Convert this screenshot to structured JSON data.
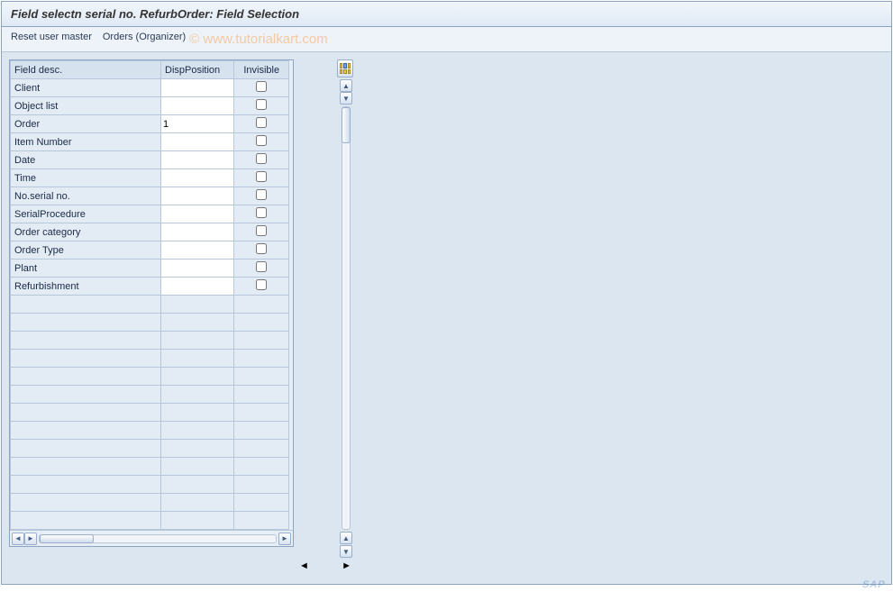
{
  "title": "Field selectn serial no. RefurbOrder: Field Selection",
  "toolbar": {
    "reset_label": "Reset user master",
    "orders_label": "Orders (Organizer)"
  },
  "watermark": "©   www.tutorialkart.com",
  "table": {
    "headers": {
      "desc": "Field desc.",
      "disp": "DispPosition",
      "inv": "Invisible"
    },
    "rows": [
      {
        "desc": "Client",
        "disp": "",
        "checkbox": true
      },
      {
        "desc": "Object list",
        "disp": "",
        "checkbox": true
      },
      {
        "desc": "Order",
        "disp": "1",
        "checkbox": true
      },
      {
        "desc": "Item Number",
        "disp": "",
        "checkbox": true
      },
      {
        "desc": "Date",
        "disp": "",
        "checkbox": true
      },
      {
        "desc": "Time",
        "disp": "",
        "checkbox": true
      },
      {
        "desc": "No.serial no.",
        "disp": "",
        "checkbox": true
      },
      {
        "desc": "SerialProcedure",
        "disp": "",
        "checkbox": true
      },
      {
        "desc": "Order category",
        "disp": "",
        "checkbox": true
      },
      {
        "desc": "Order Type",
        "disp": "",
        "checkbox": true
      },
      {
        "desc": "Plant",
        "disp": "",
        "checkbox": true
      },
      {
        "desc": "Refurbishment",
        "disp": "",
        "checkbox": true
      }
    ],
    "empty_rows": 13
  },
  "footer": {
    "sap": "SAP"
  }
}
